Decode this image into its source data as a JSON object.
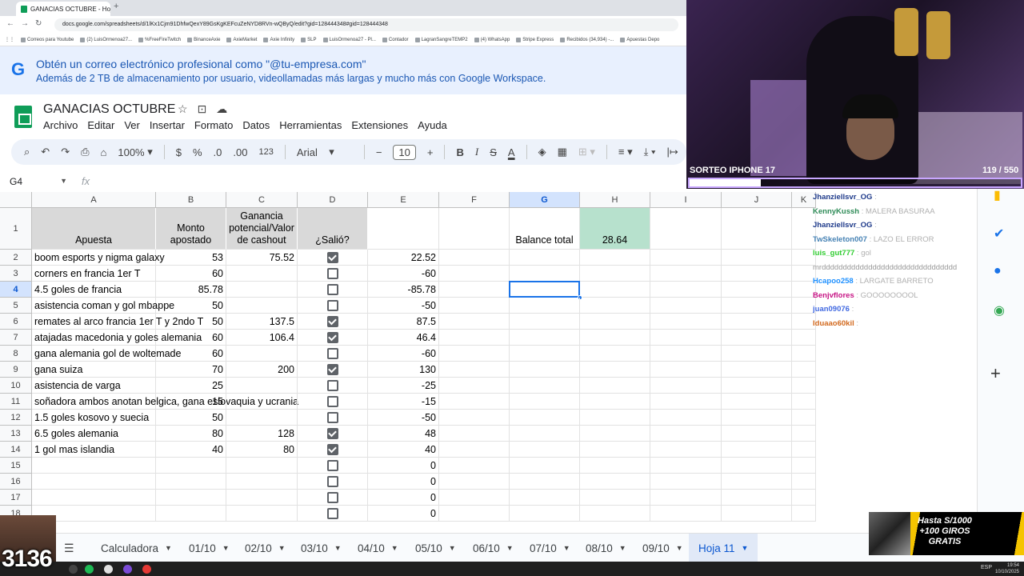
{
  "browser": {
    "tab_title": "GANACIAS OCTUBRE - Hojas de cálculo",
    "new_tab": "+",
    "url": "docs.google.com/spreadsheets/d/1lKx1Cjm91DhfwQexY89GsKgKEFcuZeNYD8RVn-wQByQ/edit?gid=128444348#gid=128444348",
    "bookmarks": [
      "Correos para Youtube",
      "(2) LuisOrmenoa27...",
      "%FreeFireTwitch",
      "BinanceAxie",
      "AxieMarket",
      "Axie Infinity",
      "SLP",
      "LuisOrmenoa27 - Pl...",
      "Contador",
      "LagranSangreTEMP2",
      "(4) WhatsApp",
      "Stripe Express",
      "Recibidos (34,934) -...",
      "Apuestas Depo"
    ]
  },
  "banner": {
    "line1": "Obtén un correo electrónico profesional como \"@tu-empresa.com\"",
    "line2": "Además de 2 TB de almacenamiento por usuario, videollamadas más largas y mucho más con Google Workspace."
  },
  "doc": {
    "title": "GANACIAS OCTUBRE",
    "menu": [
      "Archivo",
      "Editar",
      "Ver",
      "Insertar",
      "Formato",
      "Datos",
      "Herramientas",
      "Extensiones",
      "Ayuda"
    ]
  },
  "toolbar": {
    "zoom": "100%",
    "currency": "$",
    "percent": "%",
    "dec_decrease": ".0",
    "dec_increase": ".00",
    "number_format": "123",
    "font": "Arial",
    "font_size": "10",
    "minus": "−",
    "plus": "+",
    "bold": "B",
    "italic": "I",
    "strike": "S",
    "textcolor": "A"
  },
  "formula_bar": {
    "cell_ref": "G4",
    "fx": "fx",
    "content": ""
  },
  "columns": [
    "A",
    "B",
    "C",
    "D",
    "E",
    "F",
    "G",
    "H",
    "I",
    "J",
    "K"
  ],
  "selected_column": "G",
  "selected_row": 4,
  "header_row": {
    "a": "Apuesta",
    "b": "Monto apostado",
    "c": "Ganancia potencial/Valor de cashout",
    "d": "¿Salió?",
    "g": "Balance total",
    "h": "28.64"
  },
  "rows": [
    {
      "n": "2",
      "a": "boom esports y nigma galaxy",
      "b": "53",
      "c": "75.52",
      "d": true,
      "e": "22.52"
    },
    {
      "n": "3",
      "a": "corners en francia 1er T",
      "b": "60",
      "c": "",
      "d": false,
      "e": "-60"
    },
    {
      "n": "4",
      "a": "4.5 goles de francia",
      "b": "85.78",
      "c": "",
      "d": false,
      "e": "-85.78"
    },
    {
      "n": "5",
      "a": "asistencia coman y gol mbappe",
      "b": "50",
      "c": "",
      "d": false,
      "e": "-50"
    },
    {
      "n": "6",
      "a": "remates al arco francia 1er T y 2ndo T",
      "b": "50",
      "c": "137.5",
      "d": true,
      "e": "87.5"
    },
    {
      "n": "7",
      "a": "atajadas macedonia y goles alemania",
      "b": "60",
      "c": "106.4",
      "d": true,
      "e": "46.4"
    },
    {
      "n": "8",
      "a": "gana alemania gol de woltemade",
      "b": "60",
      "c": "",
      "d": false,
      "e": "-60"
    },
    {
      "n": "9",
      "a": "gana suiza",
      "b": "70",
      "c": "200",
      "d": true,
      "e": "130"
    },
    {
      "n": "10",
      "a": "asistencia de varga",
      "b": "25",
      "c": "",
      "d": false,
      "e": "-25"
    },
    {
      "n": "11",
      "a": "soñadora ambos anotan belgica, gana eslovaquia y ucrania",
      "b": "15",
      "c": "",
      "d": false,
      "e": "-15"
    },
    {
      "n": "12",
      "a": "1.5 goles kosovo y suecia",
      "b": "50",
      "c": "",
      "d": false,
      "e": "-50"
    },
    {
      "n": "13",
      "a": "6.5 goles alemania",
      "b": "80",
      "c": "128",
      "d": true,
      "e": "48"
    },
    {
      "n": "14",
      "a": "1 gol mas islandia",
      "b": "40",
      "c": "80",
      "d": true,
      "e": "40"
    },
    {
      "n": "15",
      "a": "",
      "b": "",
      "c": "",
      "d": false,
      "e": "0"
    },
    {
      "n": "16",
      "a": "",
      "b": "",
      "c": "",
      "d": false,
      "e": "0"
    },
    {
      "n": "17",
      "a": "",
      "b": "",
      "c": "",
      "d": false,
      "e": "0"
    },
    {
      "n": "18",
      "a": "",
      "b": "",
      "c": "",
      "d": false,
      "e": "0"
    }
  ],
  "sheet_tabs": [
    "Calculadora",
    "01/10",
    "02/10",
    "03/10",
    "04/10",
    "05/10",
    "06/10",
    "07/10",
    "08/10",
    "09/10",
    "Hoja 11"
  ],
  "active_sheet": "Hoja 11",
  "stream_overlay": {
    "giveaway_title": "SORTEO IPHONE 17",
    "giveaway_count": "119 / 550",
    "giveaway_progress": 0.216,
    "chat": [
      {
        "user": "Jhanziellsvr_OG",
        "msg": "",
        "color": "#1e3a8a"
      },
      {
        "user": "KennyKussh",
        "msg": "MALERA BASURAA",
        "color": "#2e8b57"
      },
      {
        "user": "Jhanziellsvr_OG",
        "msg": "",
        "color": "#1e3a8a"
      },
      {
        "user": "TwSkeleton007",
        "msg": "LAZO EL ERROR",
        "color": "#4682b4"
      },
      {
        "user": "luis_gut777",
        "msg": "gol",
        "color": "#32cd32"
      },
      {
        "user": "",
        "msg": "mrdddddddddddddddddddddddddddddddd",
        "color": "#999999"
      },
      {
        "user": "Hcapoo258",
        "msg": "LARGATE BARRETO",
        "color": "#1e90ff"
      },
      {
        "user": "Benjvflores",
        "msg": "GOOOOOOOOL",
        "color": "#c71585"
      },
      {
        "user": "juan09076",
        "msg": "",
        "color": "#4169e1"
      },
      {
        "user": "Iduaao60kil",
        "msg": "",
        "color": "#d2691e"
      }
    ],
    "promo": "Hasta S/1000 +100 GIROS GRATIS",
    "counter": "3136"
  },
  "taskbar": {
    "lang": "ESP",
    "time": "19:54",
    "date": "10/10/2025"
  }
}
